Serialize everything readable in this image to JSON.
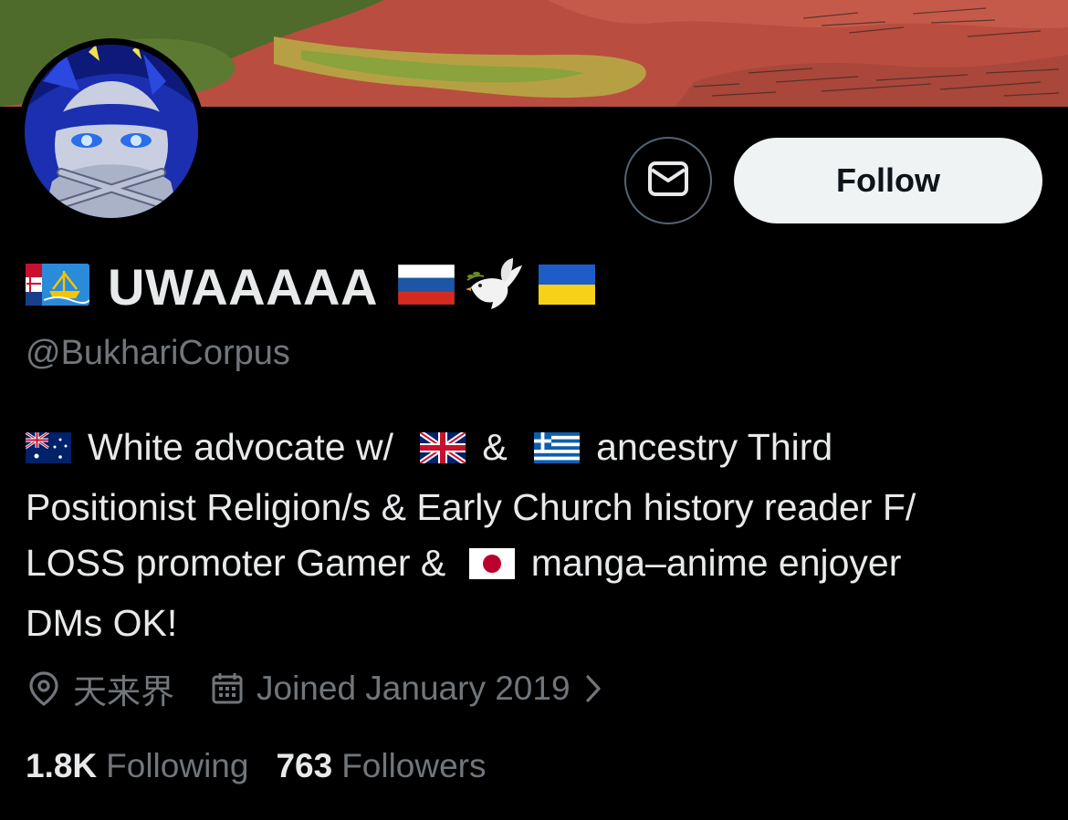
{
  "profile": {
    "display_name": "UWAAAAA",
    "handle": "@BukhariCorpus",
    "follow_label": "Follow",
    "bio_lines": [
      {
        "pre": "White advocate w/",
        "mid": "&",
        "post": "ancestry Third"
      },
      "Positionist Religion/s & Early Church history reader F/",
      {
        "pre": "LOSS promoter Gamer &",
        "post": "manga–anime enjoyer"
      },
      "DMs OK!"
    ],
    "location": "天来界",
    "joined": "Joined January 2019",
    "following_count": "1.8K",
    "following_label": "Following",
    "followers_count": "763",
    "followers_label": "Followers"
  },
  "icons": {
    "message": "mail-icon",
    "location": "location-pin-icon",
    "calendar": "calendar-icon",
    "chevron": "chevron-right-icon",
    "name_emoji": [
      "saint-pierre-miquelon-flag",
      "russia-flag",
      "dove-icon",
      "ukraine-flag"
    ],
    "bio_emoji": [
      "australia-flag",
      "uk-flag",
      "greece-flag",
      "japan-flag"
    ]
  },
  "colors": {
    "background": "#000000",
    "text_primary": "#e7e9ea",
    "text_secondary": "#71767b",
    "follow_bg": "#eff3f4",
    "follow_text": "#0f1419"
  }
}
